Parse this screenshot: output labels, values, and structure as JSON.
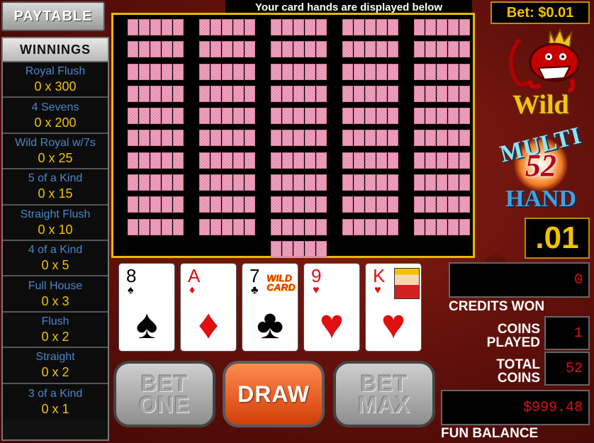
{
  "paytable_button": "PAYTABLE",
  "winnings_header": "WINNINGS",
  "paytable": [
    {
      "name": "Royal Flush",
      "value": "0 x 300"
    },
    {
      "name": "4 Sevens",
      "value": "0 x 200"
    },
    {
      "name": "Wild Royal w/7s",
      "value": "0 x 25"
    },
    {
      "name": "5 of a Kind",
      "value": "0 x 15"
    },
    {
      "name": "Straight Flush",
      "value": "0 x 10"
    },
    {
      "name": "4 of a Kind",
      "value": "0 x 5"
    },
    {
      "name": "Full House",
      "value": "0 x 3"
    },
    {
      "name": "Flush",
      "value": "0 x 2"
    },
    {
      "name": "Straight",
      "value": "0 x 2"
    },
    {
      "name": "3 of a Kind",
      "value": "0 x 1"
    }
  ],
  "top_message": "Your card hands are displayed below",
  "hands_grid": {
    "columns": [
      10,
      10,
      11,
      10,
      10
    ]
  },
  "bet_label": "Bet: $0.01",
  "logo": {
    "wild": "Wild",
    "multi": "MULTI",
    "hand_count": "52",
    "hand": "HAND"
  },
  "denomination": ".01",
  "cards": [
    {
      "rank": "8",
      "suit": "♠",
      "color": "black"
    },
    {
      "rank": "A",
      "suit": "♦",
      "color": "red"
    },
    {
      "rank": "7",
      "suit": "♣",
      "color": "black",
      "wild_label": "WILD CARD"
    },
    {
      "rank": "9",
      "suit": "♥",
      "color": "red"
    },
    {
      "rank": "K",
      "suit": "♥",
      "color": "red"
    }
  ],
  "buttons": {
    "bet_one": [
      "BET",
      "ONE"
    ],
    "draw": "DRAW",
    "bet_max": [
      "BET",
      "MAX"
    ]
  },
  "credits_won": {
    "value": "0",
    "label": "CREDITS WON"
  },
  "coins_played": {
    "value": "1",
    "label": [
      "COINS",
      "PLAYED"
    ]
  },
  "total_coins": {
    "value": "52",
    "label": [
      "TOTAL",
      "COINS"
    ]
  },
  "fun_balance": {
    "value": "$999.48",
    "label": "FUN BALANCE"
  },
  "colors": {
    "accent_gold": "#e8b800",
    "paytable_name": "#4a86c9",
    "paytable_value": "#f2c200",
    "digits_red": "#e51010"
  }
}
